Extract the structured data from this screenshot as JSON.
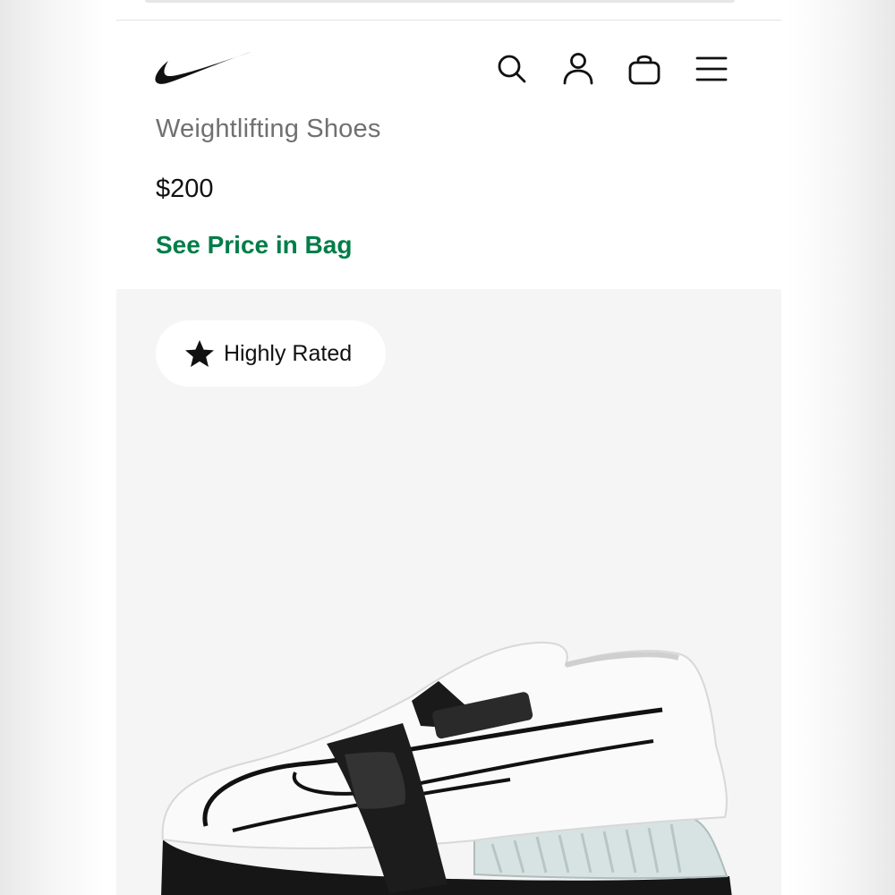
{
  "header": {
    "icons": [
      "search-icon",
      "user-icon",
      "bag-icon",
      "menu-icon"
    ]
  },
  "product": {
    "subtitle": "Weightlifting Shoes",
    "price": "$200",
    "price_link": "See Price in Bag"
  },
  "gallery": {
    "badge": {
      "icon": "star-icon",
      "label": "Highly Rated"
    },
    "image": "white weightlifting shoe with black straps"
  },
  "colors": {
    "accent_green": "#007d48",
    "text_primary": "#111111",
    "text_secondary": "#707072",
    "gallery_bg": "#f5f5f5"
  }
}
